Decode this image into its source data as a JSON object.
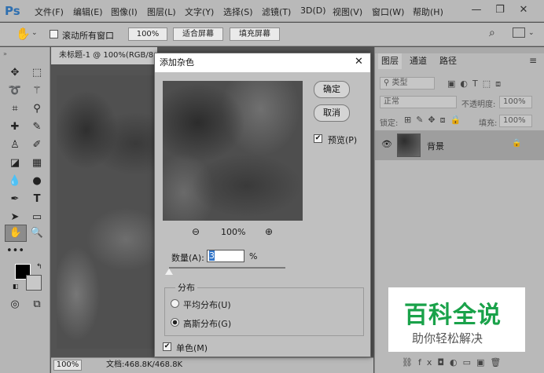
{
  "app": {
    "logo": "Ps"
  },
  "menu": [
    "文件(F)",
    "编辑(E)",
    "图像(I)",
    "图层(L)",
    "文字(Y)",
    "选择(S)",
    "滤镜(T)",
    "3D(D)",
    "视图(V)",
    "窗口(W)",
    "帮助(H)"
  ],
  "window_controls": {
    "minimize": "—",
    "restore": "❐",
    "close": "✕"
  },
  "options": {
    "scroll_all": "滚动所有窗口",
    "zoom_btn": "100%",
    "fit_screen": "适合屏幕",
    "fill_screen": "填充屏幕"
  },
  "document": {
    "tab": "未标题-1 @ 100%(RGB/8",
    "zoom": "100%",
    "doc_info": "文档:468.8K/468.8K"
  },
  "panel": {
    "tabs": [
      "图层",
      "通道",
      "路径"
    ],
    "kind": "类型",
    "blend_mode": "正常",
    "opacity_label": "不透明度:",
    "opacity": "100%",
    "lock_label": "锁定:",
    "fill_label": "填充:",
    "fill": "100%",
    "layer_name": "背景"
  },
  "dialog": {
    "title": "添加杂色",
    "ok": "确定",
    "cancel": "取消",
    "preview_label": "预览(P)",
    "zoom": "100%",
    "amount_label": "数量(A):",
    "amount_value": "3",
    "amount_unit": "%",
    "amount_slider_fraction": 0.0,
    "distribution_label": "分布",
    "uniform": "平均分布(U)",
    "gaussian": "高斯分布(G)",
    "selected": "gaussian",
    "monochrome": "单色(M)"
  },
  "watermark": {
    "title": "百科全说",
    "subtitle": "助你轻松解决"
  },
  "colors": {
    "accent": "#2e6fb0",
    "watermark_green": "#1aa24a"
  }
}
